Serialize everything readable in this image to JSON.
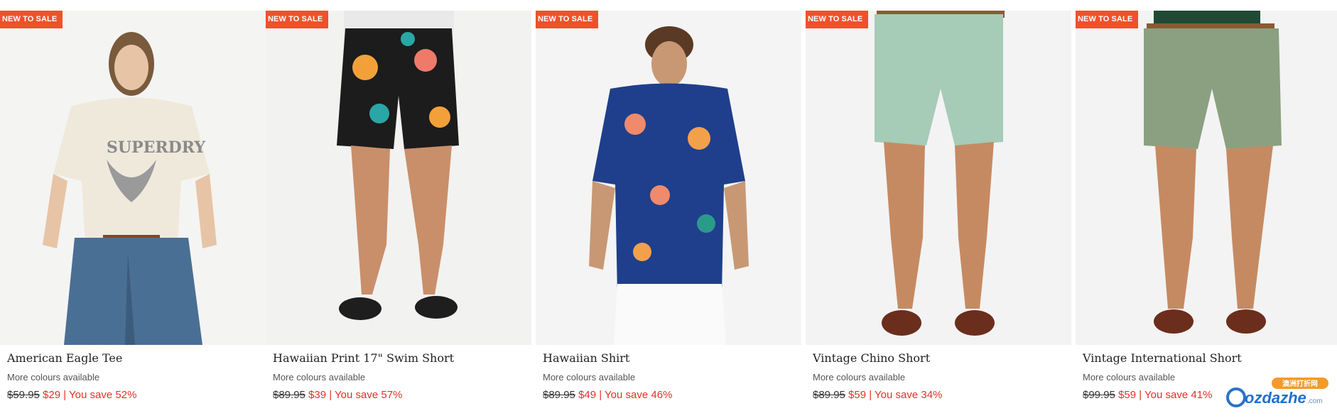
{
  "products": [
    {
      "badge": "NEW TO SALE",
      "title": "American Eagle Tee",
      "colors": "More colours available",
      "old_price": "$59.95",
      "new_price": "$29",
      "save": "| You save 52%"
    },
    {
      "badge": "NEW TO SALE",
      "title": "Hawaiian Print 17\" Swim Short",
      "colors": "More colours available",
      "old_price": "$89.95",
      "new_price": "$39",
      "save": "| You save 57%"
    },
    {
      "badge": "NEW TO SALE",
      "title": "Hawaiian Shirt",
      "colors": "More colours available",
      "old_price": "$89.95",
      "new_price": "$49",
      "save": "| You save 46%"
    },
    {
      "badge": "NEW TO SALE",
      "title": "Vintage Chino Short",
      "colors": "More colours available",
      "old_price": "$89.95",
      "new_price": "$59",
      "save": "| You save 34%"
    },
    {
      "badge": "NEW TO SALE",
      "title": "Vintage International Short",
      "colors": "More colours available",
      "old_price": "$99.95",
      "new_price": "$59",
      "save": "| You save 41%"
    }
  ],
  "watermark": {
    "site": "ozdazhe",
    "cn": "澳洲打折网",
    "tld": ".com"
  },
  "colors": {
    "badge": "#f0502c",
    "sale": "#e2302a"
  }
}
